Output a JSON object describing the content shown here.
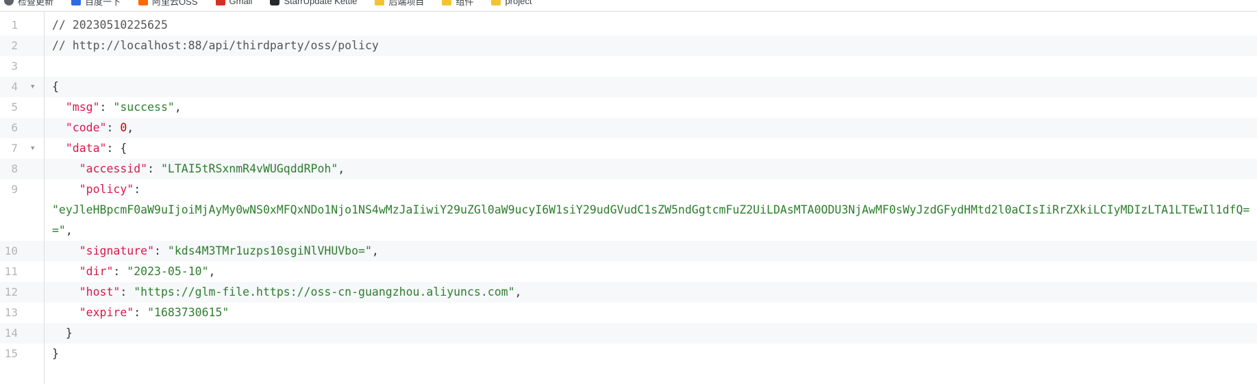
{
  "bookmarks": [
    {
      "label": "检查更新",
      "icon": "update-icon",
      "color": "#5f6368"
    },
    {
      "label": "百度一下",
      "icon": "baidu-icon",
      "color": "#2b6de5"
    },
    {
      "label": "阿里云OSS",
      "icon": "aliyun-icon",
      "color": "#ff6a00"
    },
    {
      "label": "Gmail",
      "icon": "gmail-icon",
      "color": "#d93025"
    },
    {
      "label": "StarrUpdate Kettle",
      "icon": "github-icon",
      "color": "#24292e"
    },
    {
      "label": "后端项目",
      "icon": "folder-icon",
      "color": "#f4c430"
    },
    {
      "label": "组件",
      "icon": "folder-icon",
      "color": "#f4c430"
    },
    {
      "label": "project",
      "icon": "folder-icon",
      "color": "#f4c430"
    }
  ],
  "json_viewer": {
    "line_numbers": [
      "1",
      "2",
      "3",
      "4",
      "5",
      "6",
      "7",
      "8",
      "9",
      "10",
      "11",
      "12",
      "13",
      "14",
      "15"
    ],
    "comment_date": "// 20230510225625",
    "comment_url": "// http://localhost:88/api/thirdparty/oss/policy",
    "open_brace": "{",
    "close_brace": "}",
    "msg_key": "\"msg\"",
    "msg_value": "\"success\"",
    "code_key": "\"code\"",
    "code_value": "0",
    "data_key": "\"data\"",
    "data_open": "{",
    "data_close": "}",
    "accessid_key": "\"accessid\"",
    "accessid_value": "\"LTAI5tRSxnmR4vWUGqddRPoh\"",
    "policy_key": "\"policy\"",
    "policy_value": "\"eyJleHBpcmF0aW9uIjoiMjAyMy0wNS0xMFQxNDo1Njo1NS4wMzJaIiwiY29uZGl0aW9ucyI6W1siY29udGVudC1sZW5ndGgtcmFuZ2UiLDAsMTA0ODU3NjAwMF0sWyJzdGFydHMtd2l0aCIsIiRrZXkiLCIyMDIzLTA1LTEwIl1dfQ==\"",
    "signature_key": "\"signature\"",
    "signature_value": "\"kds4M3TMr1uzps10sgiNlVHUVbo=\"",
    "dir_key": "\"dir\"",
    "dir_value": "\"2023-05-10\"",
    "host_key": "\"host\"",
    "host_value": "\"https://glm-file.https://oss-cn-guangzhou.aliyuncs.com\"",
    "expire_key": "\"expire\"",
    "expire_value": "\"1683730615\""
  },
  "colors": {
    "key": "#d9184a",
    "string": "#2d7d2d",
    "number": "#cc0000",
    "stripe": "#f6f8fa"
  }
}
